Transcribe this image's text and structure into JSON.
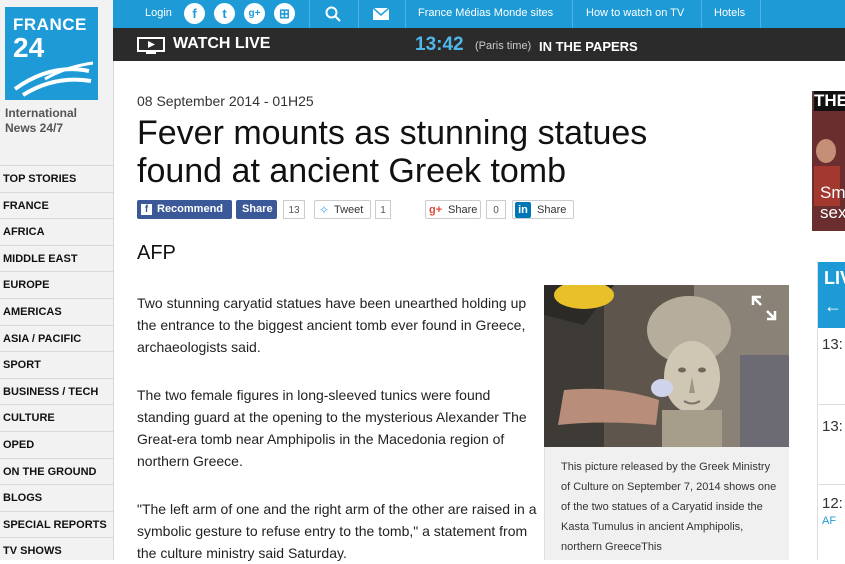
{
  "logo": {
    "line1": "FRANCE",
    "line2": "24"
  },
  "tagline": "International News 24/7",
  "nav": [
    "TOP STORIES",
    "FRANCE",
    "AFRICA",
    "MIDDLE EAST",
    "EUROPE",
    "AMERICAS",
    "ASIA / PACIFIC",
    "SPORT",
    "BUSINESS / TECH",
    "CULTURE",
    "OPED",
    "ON THE GROUND",
    "BLOGS",
    "SPECIAL REPORTS",
    "TV SHOWS"
  ],
  "topbar": {
    "login": "Login",
    "social": [
      "f",
      "t",
      "g+",
      "⊞"
    ],
    "links": [
      "France Médias Monde sites",
      "How to watch on TV",
      "Hotels"
    ]
  },
  "livebar": {
    "watch": "WATCH LIVE",
    "time": "13:42",
    "paris": "(Paris time)",
    "papers": "IN THE PAPERS"
  },
  "article": {
    "date": "08 September 2014 - 01H25",
    "title": "Fever mounts as stunning statues found at ancient Greek tomb",
    "source": "AFP",
    "paragraphs": [
      "Two stunning caryatid statues have been unearthed holding up the entrance to the biggest ancient tomb ever found in Greece, archaeologists said.",
      "The two female figures in long-sleeved tunics were found standing guard at the opening to the mysterious Alexander The Great-era tomb near Amphipolis in the Macedonia region of northern Greece.",
      "\"The left arm of one and the right arm of the other are raised in a symbolic gesture to refuse entry to the tomb,\" a statement from the culture ministry said Saturday."
    ],
    "caption": "This picture released by the Greek Ministry of Culture on September 7, 2014 shows one of the two statues of a Caryatid inside the Kasta Tumulus in ancient Amphipolis, northern GreeceThis"
  },
  "share": {
    "fb_recommend": "Recommend",
    "fb_share": "Share",
    "fb_count": "13",
    "tweet": "Tweet",
    "tweet_count": "1",
    "gplus": "Share",
    "gplus_count": "0",
    "linkedin": "Share"
  },
  "right": {
    "strip_title": "THE",
    "strip_text": "Sm sex",
    "live": "LIV",
    "arrow": "←",
    "times": [
      "13:",
      "13:",
      "12:"
    ],
    "time3_sub": "AF"
  },
  "colors": {
    "brand": "#1e9bd7",
    "dark_bar": "#2b2b2b",
    "facebook": "#3b5998"
  }
}
